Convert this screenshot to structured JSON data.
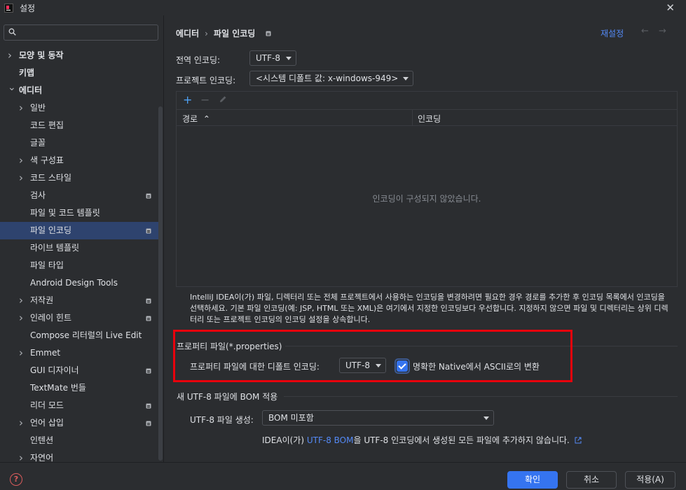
{
  "window": {
    "title": "설정"
  },
  "search": {
    "value": "",
    "placeholder": ""
  },
  "sidebar": {
    "items": [
      {
        "label": "모양 및 동작",
        "level": 0,
        "expandable": true,
        "expanded": false,
        "bold": true
      },
      {
        "label": "키맵",
        "level": 0,
        "expandable": false,
        "bold": true
      },
      {
        "label": "에디터",
        "level": 0,
        "expandable": true,
        "expanded": true,
        "bold": true
      },
      {
        "label": "일반",
        "level": 1,
        "expandable": true,
        "expanded": false
      },
      {
        "label": "코드 편집",
        "level": 1,
        "expandable": false
      },
      {
        "label": "글꼴",
        "level": 1,
        "expandable": false
      },
      {
        "label": "색 구성표",
        "level": 1,
        "expandable": true,
        "expanded": false
      },
      {
        "label": "코드 스타일",
        "level": 1,
        "expandable": true,
        "expanded": false
      },
      {
        "label": "검사",
        "level": 1,
        "expandable": false,
        "badge": true
      },
      {
        "label": "파일 및 코드 템플릿",
        "level": 1,
        "expandable": false
      },
      {
        "label": "파일 인코딩",
        "level": 1,
        "expandable": false,
        "badge": true,
        "selected": true
      },
      {
        "label": "라이브 템플릿",
        "level": 1,
        "expandable": false
      },
      {
        "label": "파일 타입",
        "level": 1,
        "expandable": false
      },
      {
        "label": "Android Design Tools",
        "level": 1,
        "expandable": false
      },
      {
        "label": "저작권",
        "level": 1,
        "expandable": true,
        "expanded": false,
        "badge": true
      },
      {
        "label": "인레이 힌트",
        "level": 1,
        "expandable": true,
        "expanded": false,
        "badge": true
      },
      {
        "label": "Compose 리터럴의 Live Edit",
        "level": 1,
        "expandable": false
      },
      {
        "label": "Emmet",
        "level": 1,
        "expandable": true,
        "expanded": false
      },
      {
        "label": "GUI 디자이너",
        "level": 1,
        "expandable": false,
        "badge": true
      },
      {
        "label": "TextMate 번들",
        "level": 1,
        "expandable": false
      },
      {
        "label": "리더 모드",
        "level": 1,
        "expandable": false,
        "badge": true
      },
      {
        "label": "언어 삽입",
        "level": 1,
        "expandable": true,
        "expanded": false,
        "badge": true
      },
      {
        "label": "인텐션",
        "level": 1,
        "expandable": false
      },
      {
        "label": "자연어",
        "level": 1,
        "expandable": true,
        "expanded": false
      }
    ]
  },
  "breadcrumb": {
    "parent": "에디터",
    "separator": "›",
    "current": "파일 인코딩"
  },
  "header": {
    "reset_label": "재설정",
    "back_icon": "arrow-left-icon",
    "forward_icon": "arrow-right-icon"
  },
  "global_encoding": {
    "label": "전역 인코딩:",
    "value": "UTF-8"
  },
  "project_encoding": {
    "label": "프로젝트 인코딩:",
    "value": "<시스템 디폴트 값: x-windows-949>"
  },
  "table": {
    "add_icon": "+",
    "remove_icon": "−",
    "edit_icon": "pencil-icon",
    "columns": [
      "경로",
      "인코딩"
    ],
    "sort_indicator": "⌃",
    "empty_text": "인코딩이 구성되지 않았습니다."
  },
  "help_text": "IntelliJ IDEA이(가) 파일, 디렉터리 또는 전체 프로젝트에서 사용하는 인코딩을 변경하려면 필요한 경우 경로를 추가한 후 인코딩 목록에서 인코딩을 선택하세요. 기본 파일 인코딩(예: JSP, HTML 또는 XML)은 여기에서 지정한 인코딩보다 우선합니다. 지정하지 않으면 파일 및 디렉터리는 상위 디렉터리 또는 프로젝트 인코딩의 인코딩 설정을 상속합니다.",
  "properties_section": {
    "title": "프로퍼티 파일(*.properties)",
    "default_encoding_label": "프로퍼티 파일에 대한 디폴트 인코딩:",
    "default_encoding_value": "UTF-8",
    "native_ascii_label": "명확한 Native에서 ASCII로의 변환",
    "native_ascii_checked": true
  },
  "bom_section": {
    "title": "새 UTF-8 파일에 BOM 적용",
    "create_label": "UTF-8 파일 생성:",
    "create_value": "BOM 미포함",
    "note_prefix": "IDEA이(가) ",
    "note_link": "UTF-8 BOM",
    "note_suffix": "을 UTF-8 인코딩에서 생성된 모든 파일에 추가하지 않습니다."
  },
  "footer": {
    "help_label": "?",
    "ok_label": "확인",
    "cancel_label": "취소",
    "apply_label": "적용(A)"
  },
  "colors": {
    "background": "#2b2d30",
    "selection": "#2e436e",
    "accent": "#3574f0",
    "link": "#548af7",
    "highlight": "#e8000c"
  }
}
